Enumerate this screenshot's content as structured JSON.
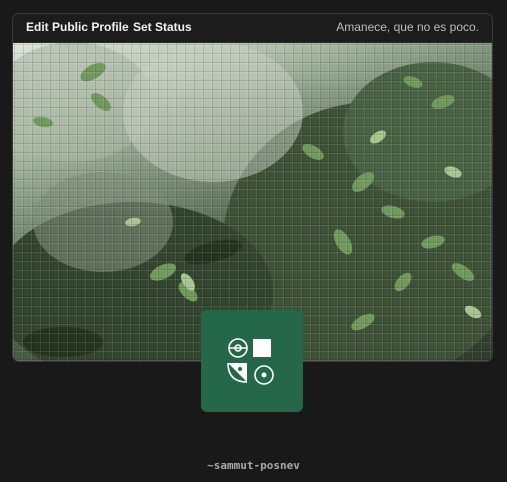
{
  "header": {
    "edit_profile_label": "Edit Public Profile",
    "set_status_label": "Set Status",
    "status_message": "Amanece, que no es poco."
  },
  "avatar": {
    "icon": "geometric-logo-icon",
    "background_color": "#256749"
  },
  "profile": {
    "username": "~sammut-posnev"
  },
  "banner": {
    "image": "plants-behind-textured-glass"
  }
}
